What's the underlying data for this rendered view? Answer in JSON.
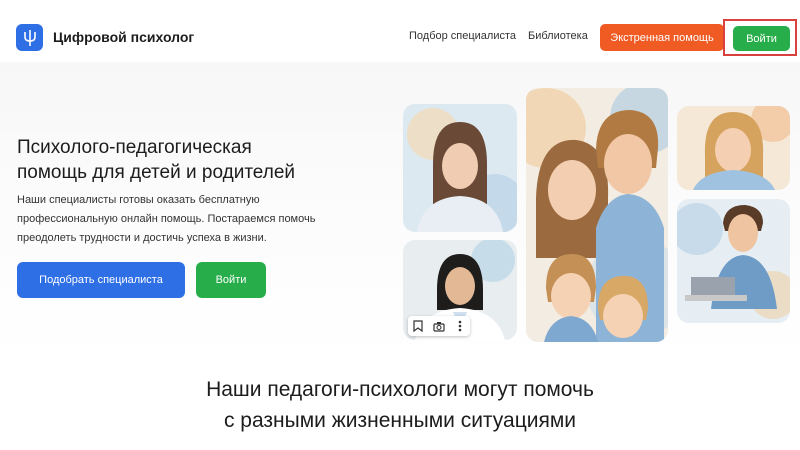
{
  "header": {
    "brand": "Цифровой психолог",
    "nav": {
      "find_specialist": "Подбор специалиста",
      "library": "Библиотека"
    },
    "emergency_button": "Экстренная помощь",
    "login_button": "Войти"
  },
  "hero": {
    "title_line1": "Психолого-педагогическая",
    "title_line2": "помощь для детей и родителей",
    "desc_line1": "Наши специалисты готовы оказать бесплатную",
    "desc_line2": "профессиональную онлайн помощь. Постараемся помочь",
    "desc_line3": "преодолеть трудности и достичь успеха в жизни.",
    "pick_button": "Подобрать специалиста",
    "login_button": "Войти"
  },
  "section": {
    "title_line1": "Наши педагоги-психологи могут помочь",
    "title_line2": "с разными жизненными ситуациями"
  },
  "colors": {
    "primary": "#2f6fe6",
    "emergency": "#f05a23",
    "login": "#27ae4a",
    "highlight": "#d9413f"
  },
  "icons": {
    "logo": "psi-logo-icon",
    "toolbar": [
      "bookmark-icon",
      "camera-icon",
      "more-vertical-icon"
    ]
  }
}
